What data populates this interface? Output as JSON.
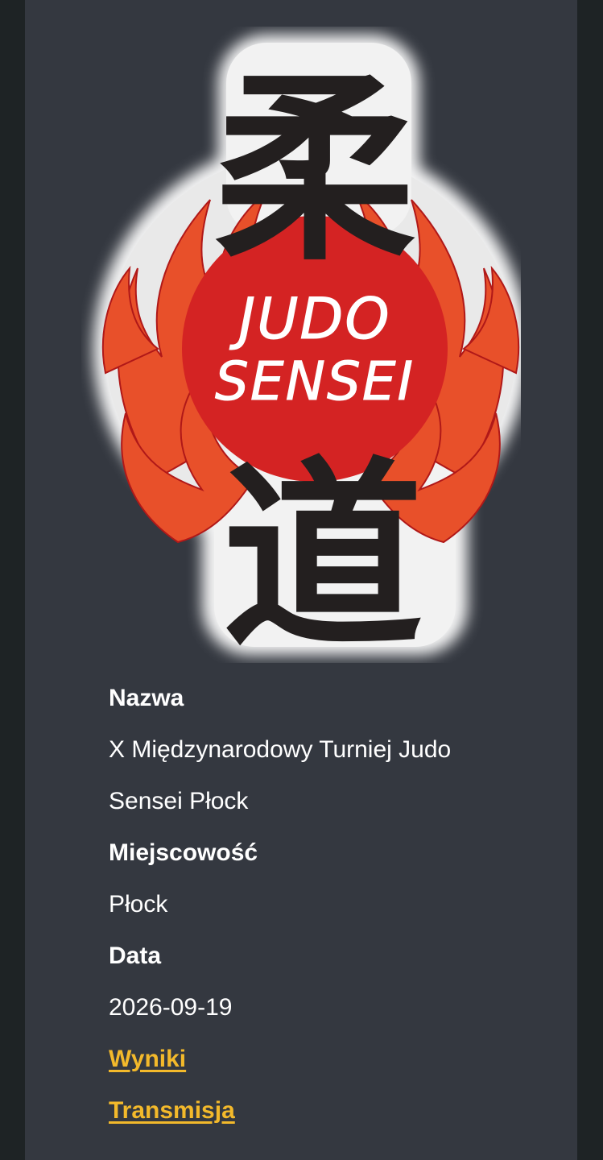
{
  "logo": {
    "text_line1": "JUDO",
    "text_line2": "SENSEI",
    "kanji_top": "柔",
    "kanji_bottom": "道"
  },
  "details": {
    "name_label": "Nazwa",
    "name_value_line1": "X Międzynarodowy Turniej Judo",
    "name_value_line2": "Sensei Płock",
    "city_label": "Miejscowość",
    "city_value": "Płock",
    "date_label": "Data",
    "date_value": "2026-09-19"
  },
  "links": {
    "results": "Wyniki",
    "stream": "Transmisja"
  },
  "colors": {
    "background": "#1e2325",
    "card": "#343840",
    "text": "#ffffff",
    "link": "#f3b92b",
    "logo_red": "#d42323",
    "flame": "#e8502a"
  }
}
